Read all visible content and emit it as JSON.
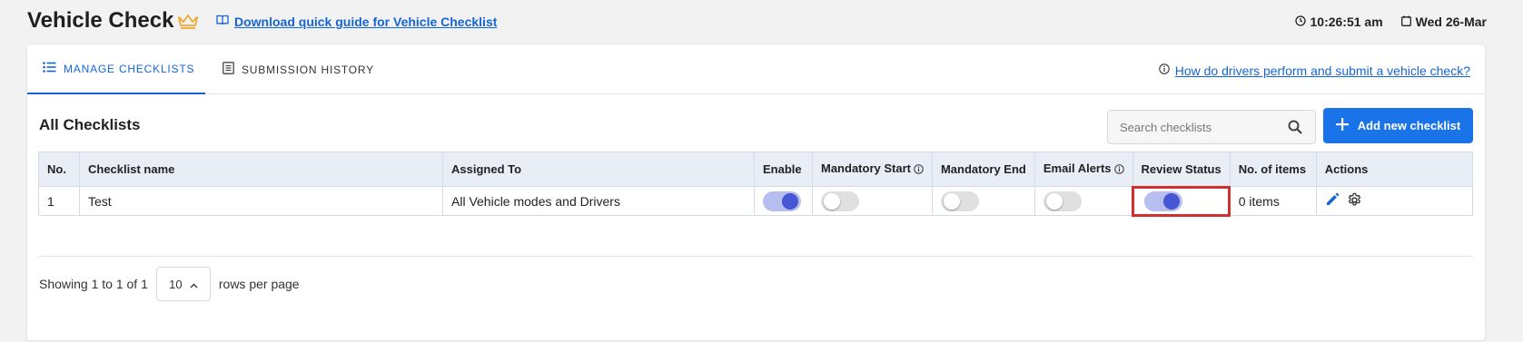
{
  "header": {
    "title": "Vehicle Check",
    "guide_link": "Download quick guide for Vehicle Checklist",
    "time": "10:26:51 am",
    "date": "Wed 26-Mar"
  },
  "tabs": [
    {
      "label": "MANAGE CHECKLISTS",
      "active": true
    },
    {
      "label": "SUBMISSION HISTORY",
      "active": false
    }
  ],
  "help_link": "How do drivers perform and submit a vehicle check?",
  "section_title": "All Checklists",
  "search": {
    "placeholder": "Search checklists"
  },
  "add_button": "Add new checklist",
  "table": {
    "columns": [
      "No.",
      "Checklist name",
      "Assigned To",
      "Enable",
      "Mandatory Start",
      "Mandatory End",
      "Email Alerts",
      "Review Status",
      "No. of items",
      "Actions"
    ],
    "rows": [
      {
        "no": "1",
        "name": "Test",
        "assigned_to": "All Vehicle modes and Drivers",
        "enable": true,
        "mandatory_start": false,
        "mandatory_end": false,
        "email_alerts": false,
        "review_status": true,
        "items": "0 items"
      }
    ]
  },
  "pagination": {
    "showing": "Showing 1 to 1 of 1",
    "rows_per_page_value": "10",
    "rows_per_page_label": "rows per page"
  },
  "colors": {
    "accent": "#1a73e8",
    "toggle_on": "#4657d4",
    "highlight": "#d32f2f"
  }
}
